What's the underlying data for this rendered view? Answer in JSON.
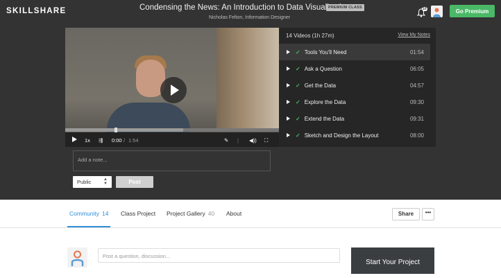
{
  "header": {
    "logo": "SKILLSHARE",
    "title": "Condensing the News: An Introduction to Data Visualization",
    "premium_tag": "PREMIUM CLASS",
    "subtitle": "Nicholas Felton, Information Designer",
    "notification_count": "10",
    "go_premium": "Go Premium"
  },
  "player": {
    "speed": "1x",
    "current_time": "0:00",
    "separator": "/",
    "total_time": "1:54",
    "progress_fraction": 0.23
  },
  "sidebar": {
    "summary": "14 Videos (1h 27m)",
    "view_notes": "View My Notes",
    "lessons": [
      {
        "name": "Tools You'll Need",
        "duration": "01:54"
      },
      {
        "name": "Ask a Question",
        "duration": "06:05"
      },
      {
        "name": "Get the Data",
        "duration": "04:57"
      },
      {
        "name": "Explore the Data",
        "duration": "09:30"
      },
      {
        "name": "Extend the Data",
        "duration": "09:31"
      },
      {
        "name": "Sketch and Design the Layout",
        "duration": "08:00"
      }
    ]
  },
  "notes": {
    "placeholder": "Add a note...",
    "visibility": "Public",
    "post": "Post"
  },
  "tabs": [
    {
      "label": "Community",
      "count": "14"
    },
    {
      "label": "Class Project",
      "count": ""
    },
    {
      "label": "Project Gallery",
      "count": "40"
    },
    {
      "label": "About",
      "count": ""
    }
  ],
  "actions": {
    "share": "Share",
    "more": "•••"
  },
  "discussion": {
    "placeholder": "Post a question, discussion...",
    "start_project": "Start Your Project"
  },
  "colors": {
    "accent_green": "#4ab866",
    "tab_blue": "#2f8fd8",
    "dark_bg": "#333333"
  }
}
